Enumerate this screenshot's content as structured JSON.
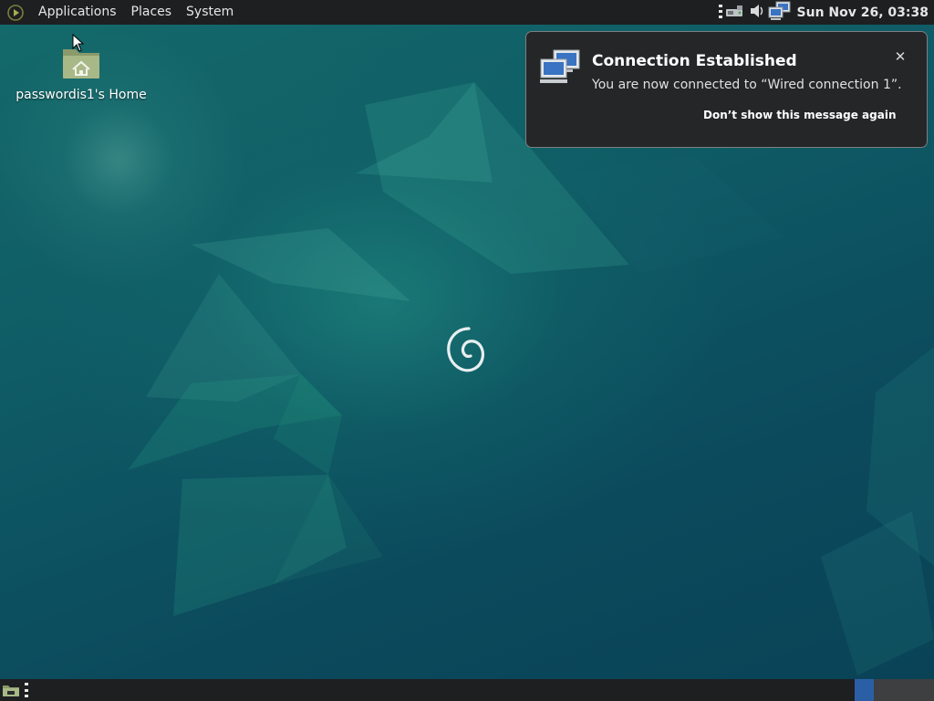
{
  "top_panel": {
    "menus": [
      "Applications",
      "Places",
      "System"
    ],
    "tray_icons": [
      "panel-handle-icon",
      "network-device-icon",
      "volume-icon",
      "network-connected-icon"
    ],
    "clock": "Sun Nov 26, 03:38"
  },
  "desktop": {
    "icons": [
      {
        "label": "passwordis1's Home",
        "icon": "home-folder-icon"
      }
    ]
  },
  "notification": {
    "title": "Connection Established",
    "body": "You are now connected to “Wired connection 1”.",
    "action": "Don’t show this message again",
    "close": "✕",
    "icon": "network-computers-icon"
  },
  "bottom_panel": {
    "workspaces": 2,
    "active_workspace": 1
  },
  "colors": {
    "panel_bg": "#1e1f21",
    "notification_bg": "#242628",
    "active_workspace": "#2a5fa6",
    "wallpaper": "#0c4a5a"
  }
}
